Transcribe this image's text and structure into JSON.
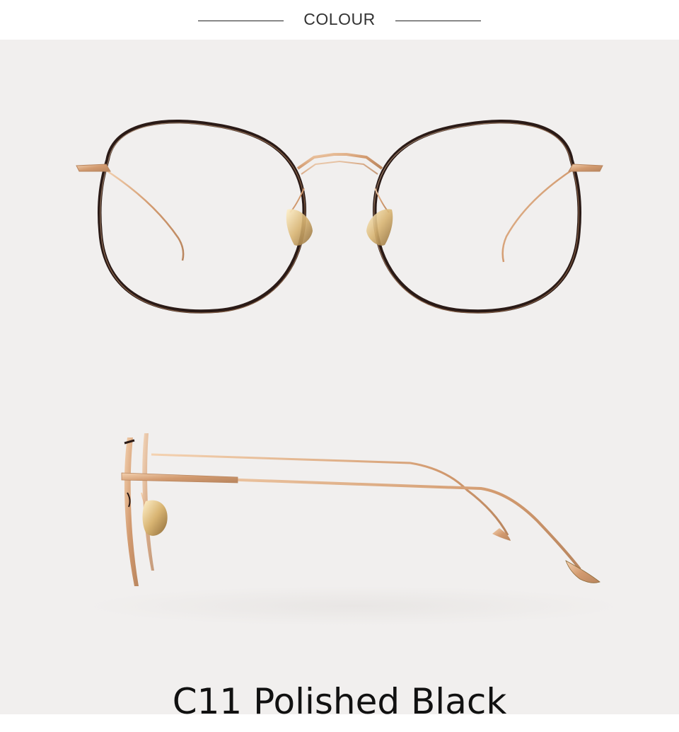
{
  "header": {
    "title": "COLOUR"
  },
  "product": {
    "caption": "C11 Polished Black"
  },
  "colors": {
    "frame_rim": "#2a1a16",
    "frame_metal": "#d9a77e",
    "background": "#f1efee"
  },
  "images": {
    "front_view": "glasses-front-view",
    "side_view": "glasses-side-view"
  }
}
